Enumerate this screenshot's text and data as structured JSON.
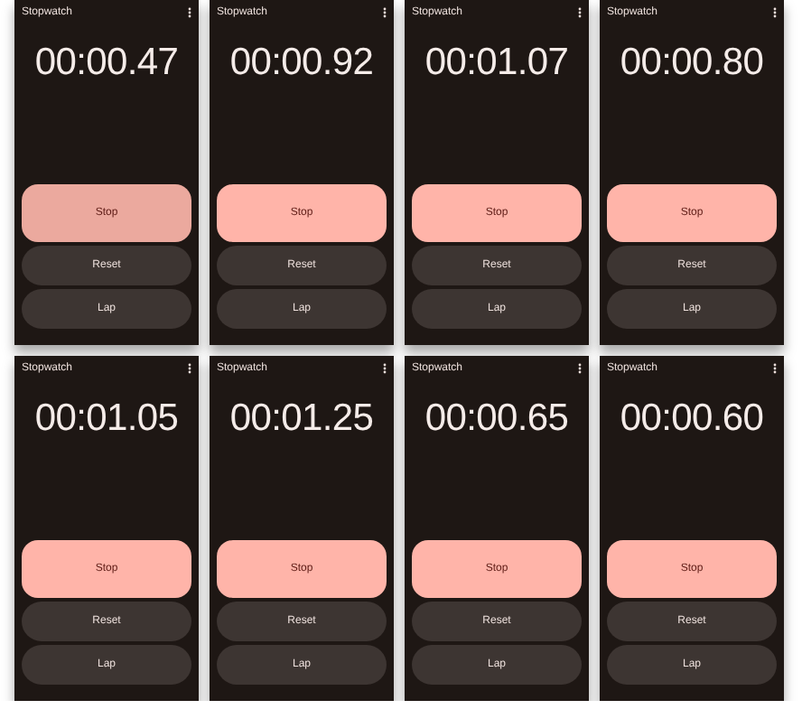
{
  "screens": [
    {
      "title": "Stopwatch",
      "time": "00:00.47",
      "buttons": [
        {
          "label": "Stop",
          "kind": "primary",
          "pressed": true
        },
        {
          "label": "Reset",
          "kind": "secondary",
          "pressed": false
        },
        {
          "label": "Lap",
          "kind": "secondary",
          "pressed": false
        }
      ]
    },
    {
      "title": "Stopwatch",
      "time": "00:00.92",
      "buttons": [
        {
          "label": "Stop",
          "kind": "primary",
          "pressed": false
        },
        {
          "label": "Reset",
          "kind": "secondary",
          "pressed": false
        },
        {
          "label": "Lap",
          "kind": "secondary",
          "pressed": false
        }
      ]
    },
    {
      "title": "Stopwatch",
      "time": "00:01.07",
      "buttons": [
        {
          "label": "Stop",
          "kind": "primary",
          "pressed": false
        },
        {
          "label": "Reset",
          "kind": "secondary",
          "pressed": false
        },
        {
          "label": "Lap",
          "kind": "secondary",
          "pressed": false
        }
      ]
    },
    {
      "title": "Stopwatch",
      "time": "00:00.80",
      "buttons": [
        {
          "label": "Stop",
          "kind": "primary",
          "pressed": false
        },
        {
          "label": "Reset",
          "kind": "secondary",
          "pressed": false
        },
        {
          "label": "Lap",
          "kind": "secondary",
          "pressed": false
        }
      ]
    },
    {
      "title": "Stopwatch",
      "time": "00:01.05",
      "buttons": [
        {
          "label": "Stop",
          "kind": "primary",
          "pressed": false
        },
        {
          "label": "Reset",
          "kind": "secondary",
          "pressed": false
        },
        {
          "label": "Lap",
          "kind": "secondary",
          "pressed": false
        }
      ]
    },
    {
      "title": "Stopwatch",
      "time": "00:01.25",
      "buttons": [
        {
          "label": "Stop",
          "kind": "primary",
          "pressed": false
        },
        {
          "label": "Reset",
          "kind": "secondary",
          "pressed": false
        },
        {
          "label": "Lap",
          "kind": "secondary",
          "pressed": false
        }
      ]
    },
    {
      "title": "Stopwatch",
      "time": "00:00.65",
      "buttons": [
        {
          "label": "Stop",
          "kind": "primary",
          "pressed": false
        },
        {
          "label": "Reset",
          "kind": "secondary",
          "pressed": false
        },
        {
          "label": "Lap",
          "kind": "secondary",
          "pressed": false
        }
      ]
    },
    {
      "title": "Stopwatch",
      "time": "00:00.60",
      "buttons": [
        {
          "label": "Stop",
          "kind": "primary",
          "pressed": false
        },
        {
          "label": "Reset",
          "kind": "secondary",
          "pressed": false
        },
        {
          "label": "Lap",
          "kind": "secondary",
          "pressed": false
        }
      ]
    }
  ]
}
